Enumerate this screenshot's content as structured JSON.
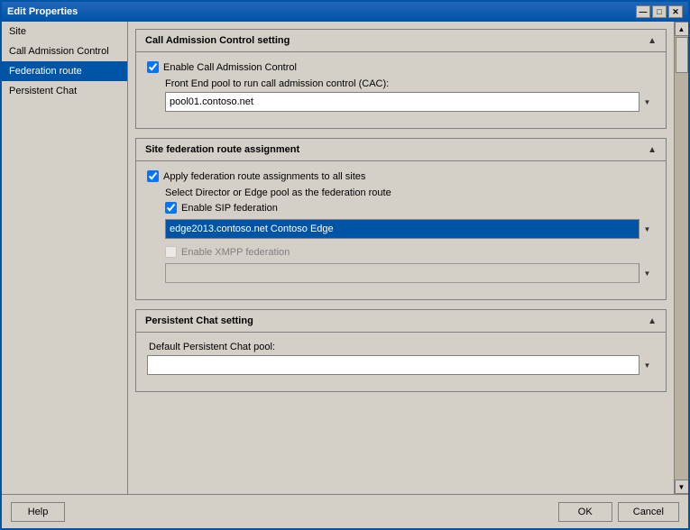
{
  "window": {
    "title": "Edit Properties",
    "controls": {
      "minimize": "—",
      "maximize": "□",
      "close": "✕"
    }
  },
  "sidebar": {
    "items": [
      {
        "id": "site",
        "label": "Site",
        "active": false
      },
      {
        "id": "call-admission-control",
        "label": "Call Admission Control",
        "active": false
      },
      {
        "id": "federation-route",
        "label": "Federation route",
        "active": true
      },
      {
        "id": "persistent-chat",
        "label": "Persistent Chat",
        "active": false
      }
    ]
  },
  "sections": {
    "call_admission_control": {
      "title": "Call Admission Control setting",
      "enable_cac_label": "Enable Call Admission Control",
      "enable_cac_checked": true,
      "frontend_pool_label": "Front End pool to run call admission control (CAC):",
      "frontend_pool_value": "pool01.contoso.net"
    },
    "site_federation": {
      "title": "Site federation route assignment",
      "apply_federation_label": "Apply federation route assignments to all sites",
      "apply_federation_checked": true,
      "select_label": "Select Director or Edge pool as the federation route",
      "enable_sip_label": "Enable SIP federation",
      "enable_sip_checked": true,
      "sip_pool_value": "edge2013.contoso.net   Contoso   Edge",
      "enable_xmpp_label": "Enable XMPP federation",
      "enable_xmpp_checked": false,
      "enable_xmpp_disabled": true,
      "xmpp_pool_value": ""
    },
    "persistent_chat": {
      "title": "Persistent Chat setting",
      "default_pool_label": "Default Persistent Chat pool:",
      "default_pool_value": ""
    }
  },
  "footer": {
    "help_label": "Help",
    "ok_label": "OK",
    "cancel_label": "Cancel"
  },
  "icons": {
    "arrow_up": "▲",
    "arrow_down": "▼",
    "scroll_up": "▲",
    "scroll_down": "▼"
  }
}
